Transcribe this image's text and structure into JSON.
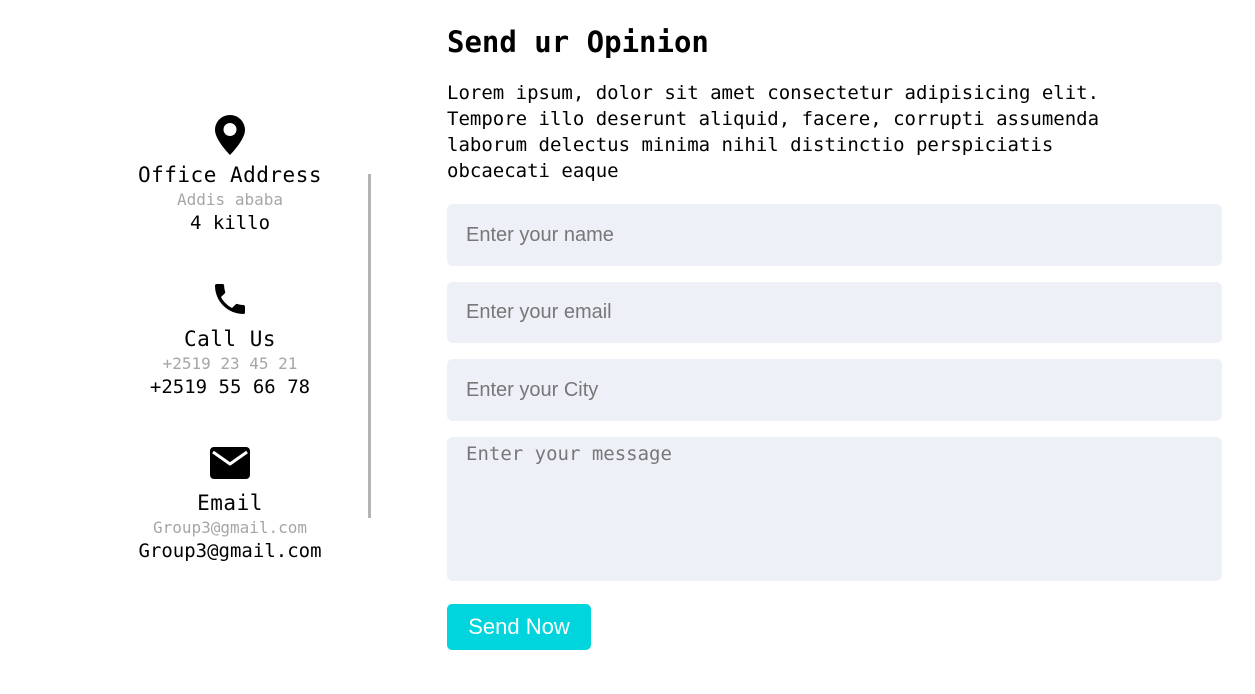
{
  "contact": {
    "office": {
      "icon": "location-pin-icon",
      "title": "Office Address",
      "sub": "Addis ababa",
      "main": "4 killo"
    },
    "phone": {
      "icon": "phone-icon",
      "title": "Call Us",
      "sub": "+2519 23 45 21",
      "main": "+2519 55 66 78"
    },
    "email": {
      "icon": "envelope-icon",
      "title": "Email",
      "sub": "Group3@gmail.com",
      "main": "Group3@gmail.com"
    }
  },
  "form": {
    "title": "Send ur Opinion",
    "description": "Lorem ipsum, dolor sit amet consectetur adipisicing elit. Tempore illo deserunt aliquid, facere, corrupti assumenda laborum delectus minima nihil distinctio perspiciatis obcaecati eaque",
    "name_placeholder": "Enter your name",
    "email_placeholder": "Enter your email",
    "city_placeholder": "Enter your City",
    "message_placeholder": "Enter your message",
    "submit_label": "Send Now"
  },
  "colors": {
    "accent": "#00d4dd",
    "field_bg": "#edf0f7",
    "muted_text": "#a6a6a6",
    "divider": "#b3b3b3"
  }
}
